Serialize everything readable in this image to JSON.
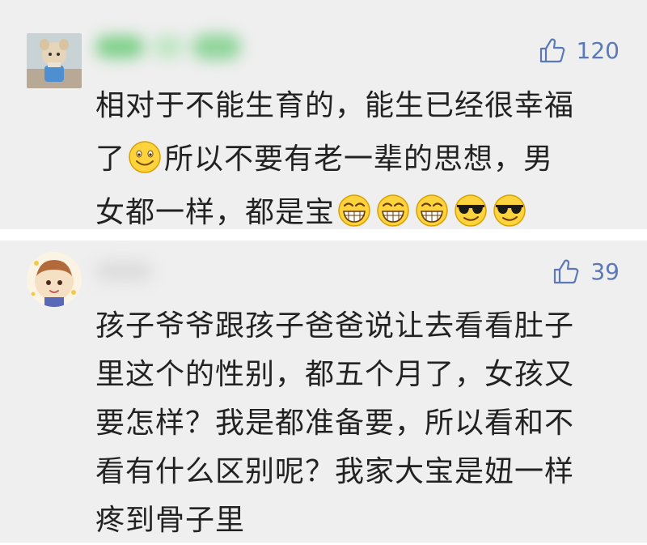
{
  "comments": [
    {
      "likes": "120",
      "text_lines": [
        "相对于不能生育的，能生已经很幸福",
        "所以不要有老一辈的思想，男",
        "女都一样，都是宝"
      ],
      "line2_prefix": "了",
      "emojis_line2": [
        "smile-emoji"
      ],
      "emojis_line3": [
        "grin-emoji",
        "grin-emoji",
        "grin-emoji",
        "cool-emoji",
        "cool-emoji"
      ]
    },
    {
      "likes": "39",
      "text_lines": [
        "孩子爷爷跟孩子爸爸说让去看看肚子",
        "里这个的性别，都五个月了，女孩又",
        "要怎样？我是都准备要，所以看和不",
        "看有什么区别呢？我家大宝是妞一样",
        "疼到骨子里"
      ]
    }
  ],
  "icons": {
    "like": "thumbs-up-icon"
  },
  "colors": {
    "background": "#efefef",
    "like_color": "#5b79b6",
    "text": "#222222"
  }
}
